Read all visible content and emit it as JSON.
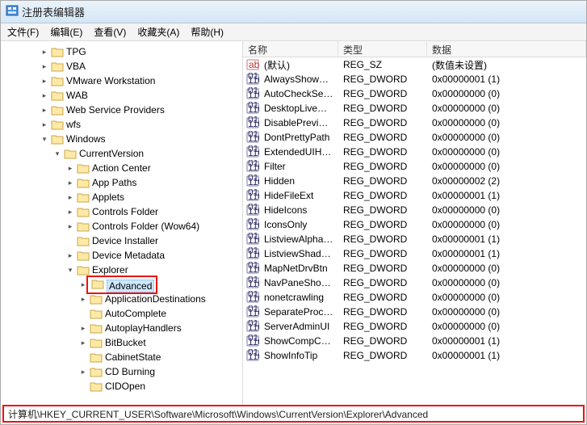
{
  "title": "注册表编辑器",
  "menubar": {
    "file": "文件(F)",
    "edit": "编辑(E)",
    "view": "查看(V)",
    "fav": "收藏夹(A)",
    "help": "帮助(H)"
  },
  "tree": {
    "items": [
      {
        "label": "TPG",
        "indent": 3,
        "exp": "collapsed"
      },
      {
        "label": "VBA",
        "indent": 3,
        "exp": "collapsed"
      },
      {
        "label": "VMware Workstation",
        "indent": 3,
        "exp": "collapsed"
      },
      {
        "label": "WAB",
        "indent": 3,
        "exp": "collapsed"
      },
      {
        "label": "Web Service Providers",
        "indent": 3,
        "exp": "collapsed"
      },
      {
        "label": "wfs",
        "indent": 3,
        "exp": "collapsed"
      },
      {
        "label": "Windows",
        "indent": 3,
        "exp": "expanded"
      },
      {
        "label": "CurrentVersion",
        "indent": 4,
        "exp": "expanded"
      },
      {
        "label": "Action Center",
        "indent": 5,
        "exp": "collapsed"
      },
      {
        "label": "App Paths",
        "indent": 5,
        "exp": "collapsed"
      },
      {
        "label": "Applets",
        "indent": 5,
        "exp": "collapsed"
      },
      {
        "label": "Controls Folder",
        "indent": 5,
        "exp": "collapsed"
      },
      {
        "label": "Controls Folder (Wow64)",
        "indent": 5,
        "exp": "collapsed"
      },
      {
        "label": "Device Installer",
        "indent": 5,
        "exp": "none"
      },
      {
        "label": "Device Metadata",
        "indent": 5,
        "exp": "collapsed"
      },
      {
        "label": "Explorer",
        "indent": 5,
        "exp": "expanded"
      },
      {
        "label": "Advanced",
        "indent": 6,
        "exp": "collapsed",
        "selected": true,
        "highlight": true
      },
      {
        "label": "ApplicationDestinations",
        "indent": 6,
        "exp": "collapsed"
      },
      {
        "label": "AutoComplete",
        "indent": 6,
        "exp": "none"
      },
      {
        "label": "AutoplayHandlers",
        "indent": 6,
        "exp": "collapsed"
      },
      {
        "label": "BitBucket",
        "indent": 6,
        "exp": "collapsed"
      },
      {
        "label": "CabinetState",
        "indent": 6,
        "exp": "none"
      },
      {
        "label": "CD Burning",
        "indent": 6,
        "exp": "collapsed"
      },
      {
        "label": "CIDOpen",
        "indent": 6,
        "exp": "none"
      }
    ]
  },
  "list": {
    "headers": {
      "name": "名称",
      "type": "类型",
      "data": "数据"
    },
    "rows": [
      {
        "icon": "sz",
        "name": "(默认)",
        "type": "REG_SZ",
        "data": "(数值未设置)"
      },
      {
        "icon": "dw",
        "name": "AlwaysShowMe...",
        "type": "REG_DWORD",
        "data": "0x00000001 (1)"
      },
      {
        "icon": "dw",
        "name": "AutoCheckSelect",
        "type": "REG_DWORD",
        "data": "0x00000000 (0)"
      },
      {
        "icon": "dw",
        "name": "DesktopLivePrev...",
        "type": "REG_DWORD",
        "data": "0x00000000 (0)"
      },
      {
        "icon": "dw",
        "name": "DisablePreviewD...",
        "type": "REG_DWORD",
        "data": "0x00000000 (0)"
      },
      {
        "icon": "dw",
        "name": "DontPrettyPath",
        "type": "REG_DWORD",
        "data": "0x00000000 (0)"
      },
      {
        "icon": "dw",
        "name": "ExtendedUIHove...",
        "type": "REG_DWORD",
        "data": "0x00000000 (0)"
      },
      {
        "icon": "dw",
        "name": "Filter",
        "type": "REG_DWORD",
        "data": "0x00000000 (0)"
      },
      {
        "icon": "dw",
        "name": "Hidden",
        "type": "REG_DWORD",
        "data": "0x00000002 (2)"
      },
      {
        "icon": "dw",
        "name": "HideFileExt",
        "type": "REG_DWORD",
        "data": "0x00000001 (1)"
      },
      {
        "icon": "dw",
        "name": "HideIcons",
        "type": "REG_DWORD",
        "data": "0x00000000 (0)"
      },
      {
        "icon": "dw",
        "name": "IconsOnly",
        "type": "REG_DWORD",
        "data": "0x00000000 (0)"
      },
      {
        "icon": "dw",
        "name": "ListviewAlphaSe...",
        "type": "REG_DWORD",
        "data": "0x00000001 (1)"
      },
      {
        "icon": "dw",
        "name": "ListviewShadow",
        "type": "REG_DWORD",
        "data": "0x00000001 (1)"
      },
      {
        "icon": "dw",
        "name": "MapNetDrvBtn",
        "type": "REG_DWORD",
        "data": "0x00000000 (0)"
      },
      {
        "icon": "dw",
        "name": "NavPaneShowAl...",
        "type": "REG_DWORD",
        "data": "0x00000000 (0)"
      },
      {
        "icon": "dw",
        "name": "nonetcrawling",
        "type": "REG_DWORD",
        "data": "0x00000000 (0)"
      },
      {
        "icon": "dw",
        "name": "SeparateProcess",
        "type": "REG_DWORD",
        "data": "0x00000000 (0)"
      },
      {
        "icon": "dw",
        "name": "ServerAdminUI",
        "type": "REG_DWORD",
        "data": "0x00000000 (0)"
      },
      {
        "icon": "dw",
        "name": "ShowCompColor",
        "type": "REG_DWORD",
        "data": "0x00000001 (1)"
      },
      {
        "icon": "dw",
        "name": "ShowInfoTip",
        "type": "REG_DWORD",
        "data": "0x00000001 (1)"
      }
    ]
  },
  "statusbar": "计算机\\HKEY_CURRENT_USER\\Software\\Microsoft\\Windows\\CurrentVersion\\Explorer\\Advanced"
}
